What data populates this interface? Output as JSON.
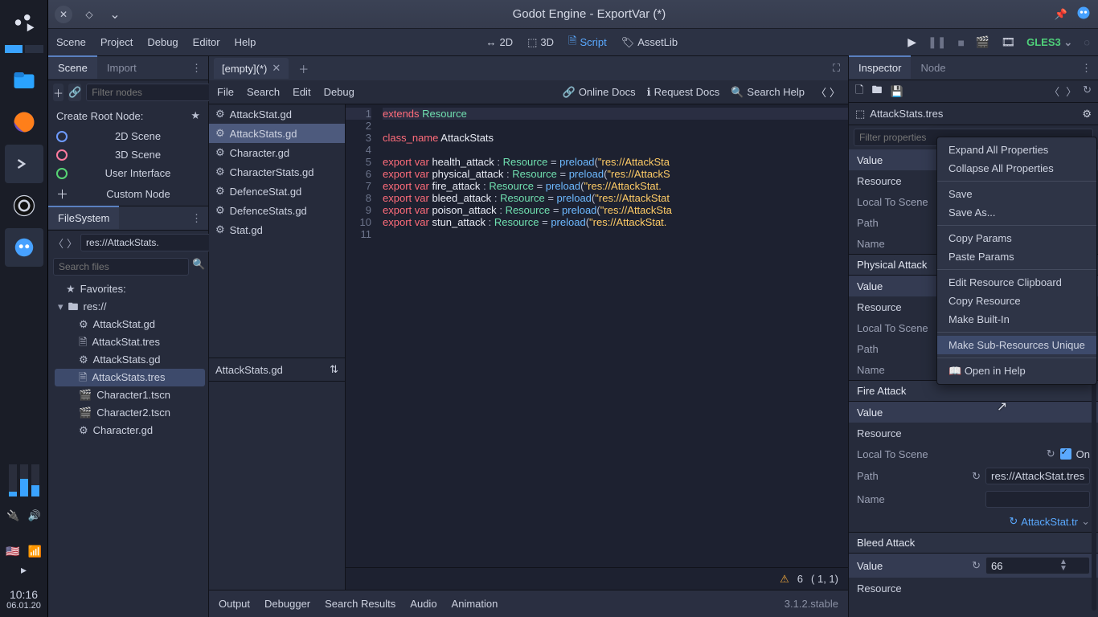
{
  "taskbar": {
    "clock": "10:16",
    "date": "06.01.20"
  },
  "titlebar": {
    "title": "Godot Engine - ExportVar (*)"
  },
  "menubar": {
    "items": [
      "Scene",
      "Project",
      "Debug",
      "Editor",
      "Help"
    ],
    "workspaces": {
      "w2d": "2D",
      "w3d": "3D",
      "script": "Script",
      "assetlib": "AssetLib"
    },
    "renderer": "GLES3"
  },
  "scene_dock": {
    "tabs": [
      "Scene",
      "Import"
    ],
    "filter_placeholder": "Filter nodes",
    "create_label": "Create Root Node:",
    "roots": {
      "s2d": "2D Scene",
      "s3d": "3D Scene",
      "ui": "User Interface",
      "custom": "Custom Node"
    }
  },
  "filesystem_dock": {
    "tab": "FileSystem",
    "path": "res://AttackStats.",
    "search_placeholder": "Search files",
    "favorites": "Favorites:",
    "root": "res://",
    "items": [
      {
        "icon": "gear",
        "name": "AttackStat.gd"
      },
      {
        "icon": "doc",
        "name": "AttackStat.tres"
      },
      {
        "icon": "gear",
        "name": "AttackStats.gd"
      },
      {
        "icon": "doc",
        "name": "AttackStats.tres",
        "selected": true
      },
      {
        "icon": "clap",
        "name": "Character1.tscn"
      },
      {
        "icon": "clap",
        "name": "Character2.tscn"
      },
      {
        "icon": "gear",
        "name": "Character.gd"
      }
    ]
  },
  "center": {
    "scene_tab": "[empty](*)",
    "menu": [
      "File",
      "Search",
      "Edit",
      "Debug"
    ],
    "help": {
      "online": "Online Docs",
      "request": "Request Docs",
      "search": "Search Help"
    },
    "scripts": [
      "AttackStat.gd",
      "AttackStats.gd",
      "Character.gd",
      "CharacterStats.gd",
      "DefenceStat.gd",
      "DefenceStats.gd",
      "Stat.gd"
    ],
    "active_script_index": 1,
    "method_label": "AttackStats.gd",
    "status": {
      "warn_icon": "⚠",
      "count": "6",
      "cursor": "(   1,   1)"
    }
  },
  "code": {
    "lines": [
      {
        "n": 1,
        "t": "extends Resource",
        "hl": true
      },
      {
        "n": 2,
        "t": ""
      },
      {
        "n": 3,
        "t": "class_name AttackStats"
      },
      {
        "n": 4,
        "t": ""
      },
      {
        "n": 5,
        "t": "export var health_attack : Resource = preload(\"res://AttackSta"
      },
      {
        "n": 6,
        "t": "export var physical_attack : Resource = preload(\"res://AttackS"
      },
      {
        "n": 7,
        "t": "export var fire_attack : Resource = preload(\"res://AttackStat."
      },
      {
        "n": 8,
        "t": "export var bleed_attack : Resource = preload(\"res://AttackStat"
      },
      {
        "n": 9,
        "t": "export var poison_attack : Resource = preload(\"res://AttackSta"
      },
      {
        "n": 10,
        "t": "export var stun_attack : Resource = preload(\"res://AttackStat."
      },
      {
        "n": 11,
        "t": ""
      }
    ]
  },
  "bottom_panel": {
    "items": [
      "Output",
      "Debugger",
      "Search Results",
      "Audio",
      "Animation"
    ],
    "version": "3.1.2.stable"
  },
  "inspector": {
    "tabs": [
      "Inspector",
      "Node"
    ],
    "resource_name": "AttackStats.tres",
    "filter_placeholder": "Filter properties",
    "sections": {
      "health": {
        "value_label": "Value",
        "resource": "Resource",
        "local": "Local To Scene",
        "path": "Path",
        "name": "Name"
      },
      "physical": {
        "title": "Physical Attack",
        "value_label": "Value",
        "resource": "Resource",
        "local": "Local To Scene",
        "path": "Path",
        "name": "Name"
      },
      "fire": {
        "title": "Fire Attack",
        "value_label": "Value",
        "resource": "Resource",
        "local": "Local To Scene",
        "on": "On",
        "path": "Path",
        "path_value": "res://AttackStat.tres",
        "name": "Name",
        "res_chip": "AttackStat.tr"
      },
      "bleed": {
        "title": "Bleed Attack",
        "value_label": "Value",
        "value": "66",
        "resource": "Resource"
      }
    }
  },
  "context_menu": {
    "items1": [
      "Expand All Properties",
      "Collapse All Properties"
    ],
    "items2": [
      "Save",
      "Save As..."
    ],
    "items3": [
      "Copy Params",
      "Paste Params"
    ],
    "items4": [
      "Edit Resource Clipboard",
      "Copy Resource",
      "Make Built-In"
    ],
    "items5": [
      "Make Sub-Resources Unique"
    ],
    "open_help": "Open in Help"
  }
}
